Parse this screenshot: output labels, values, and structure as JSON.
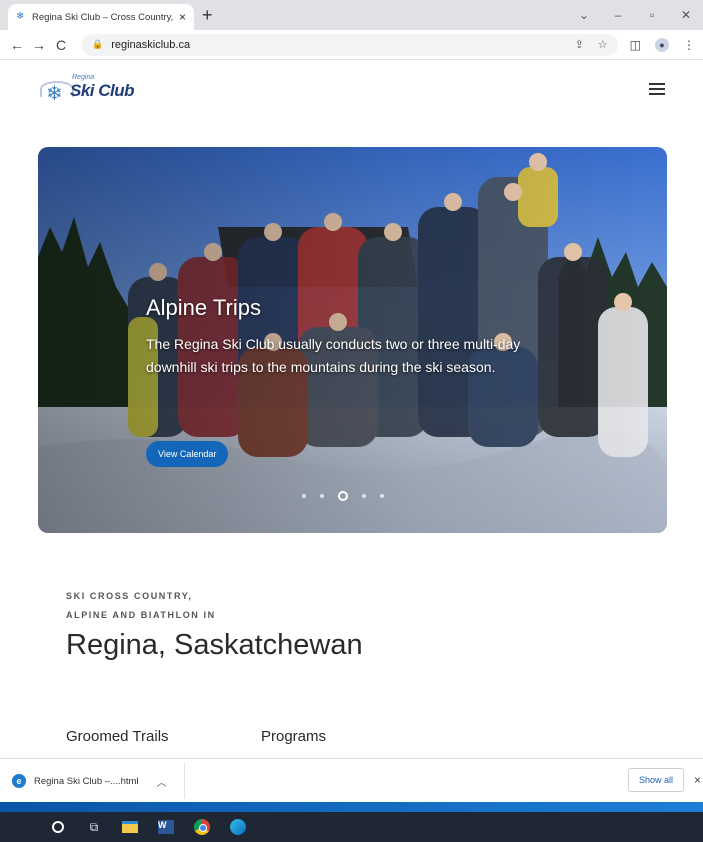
{
  "browser": {
    "tab_title": "Regina Ski Club – Cross Country,",
    "tab_close": "×",
    "new_tab": "+",
    "url": "reginaskiclub.ca"
  },
  "site": {
    "logo_small": "Regina",
    "logo_text": "Ski Club"
  },
  "hero": {
    "title": "Alpine Trips",
    "description": "The Regina Ski Club usually conducts two or three multi-day downhill ski trips to the mountains during the ski season.",
    "button_label": "View Calendar",
    "slide_count": 5,
    "active_slide": 3
  },
  "intro": {
    "kicker_line1": "SKI CROSS COUNTRY,",
    "kicker_line2": "ALPINE AND BIATHLON IN",
    "headline": "Regina, Saskatchewan",
    "links": [
      "Groomed Trails",
      "Programs"
    ]
  },
  "downloads": {
    "file_name": "Regina Ski Club –....html",
    "show_all": "Show all",
    "close": "×"
  },
  "icons": {
    "tab_favicon": "snowflake-icon",
    "back": "arrow-left-icon",
    "forward": "arrow-right-icon",
    "reload": "reload-icon",
    "lock": "lock-icon",
    "share": "share-icon",
    "bookmark": "star-icon",
    "sidebar": "sidebar-icon",
    "profile": "profile-icon",
    "menu": "hamburger-menu-icon"
  },
  "colors": {
    "primary_button": "#1466b8",
    "logo_blue": "#1f3d7a",
    "taskbar": "#1e2733"
  }
}
